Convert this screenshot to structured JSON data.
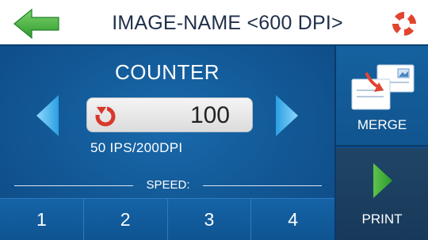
{
  "header": {
    "title": "IMAGE-NAME <600 DPI>",
    "back_icon": "back-arrow-icon",
    "help_icon": "lifebuoy-icon"
  },
  "counter": {
    "label": "COUNTER",
    "value": "100",
    "reset_icon": "reset-icon",
    "prev_icon": "chevron-left-icon",
    "next_icon": "chevron-right-icon"
  },
  "speed_info": "50 IPS/200DPI",
  "speed": {
    "label": "SPEED:",
    "options": [
      "1",
      "2",
      "3",
      "4"
    ]
  },
  "actions": {
    "merge_label": "MERGE",
    "print_label": "PRINT"
  },
  "colors": {
    "accent_green": "#3bb24a",
    "panel_blue": "#135a98",
    "reset_red": "#d8382b"
  }
}
